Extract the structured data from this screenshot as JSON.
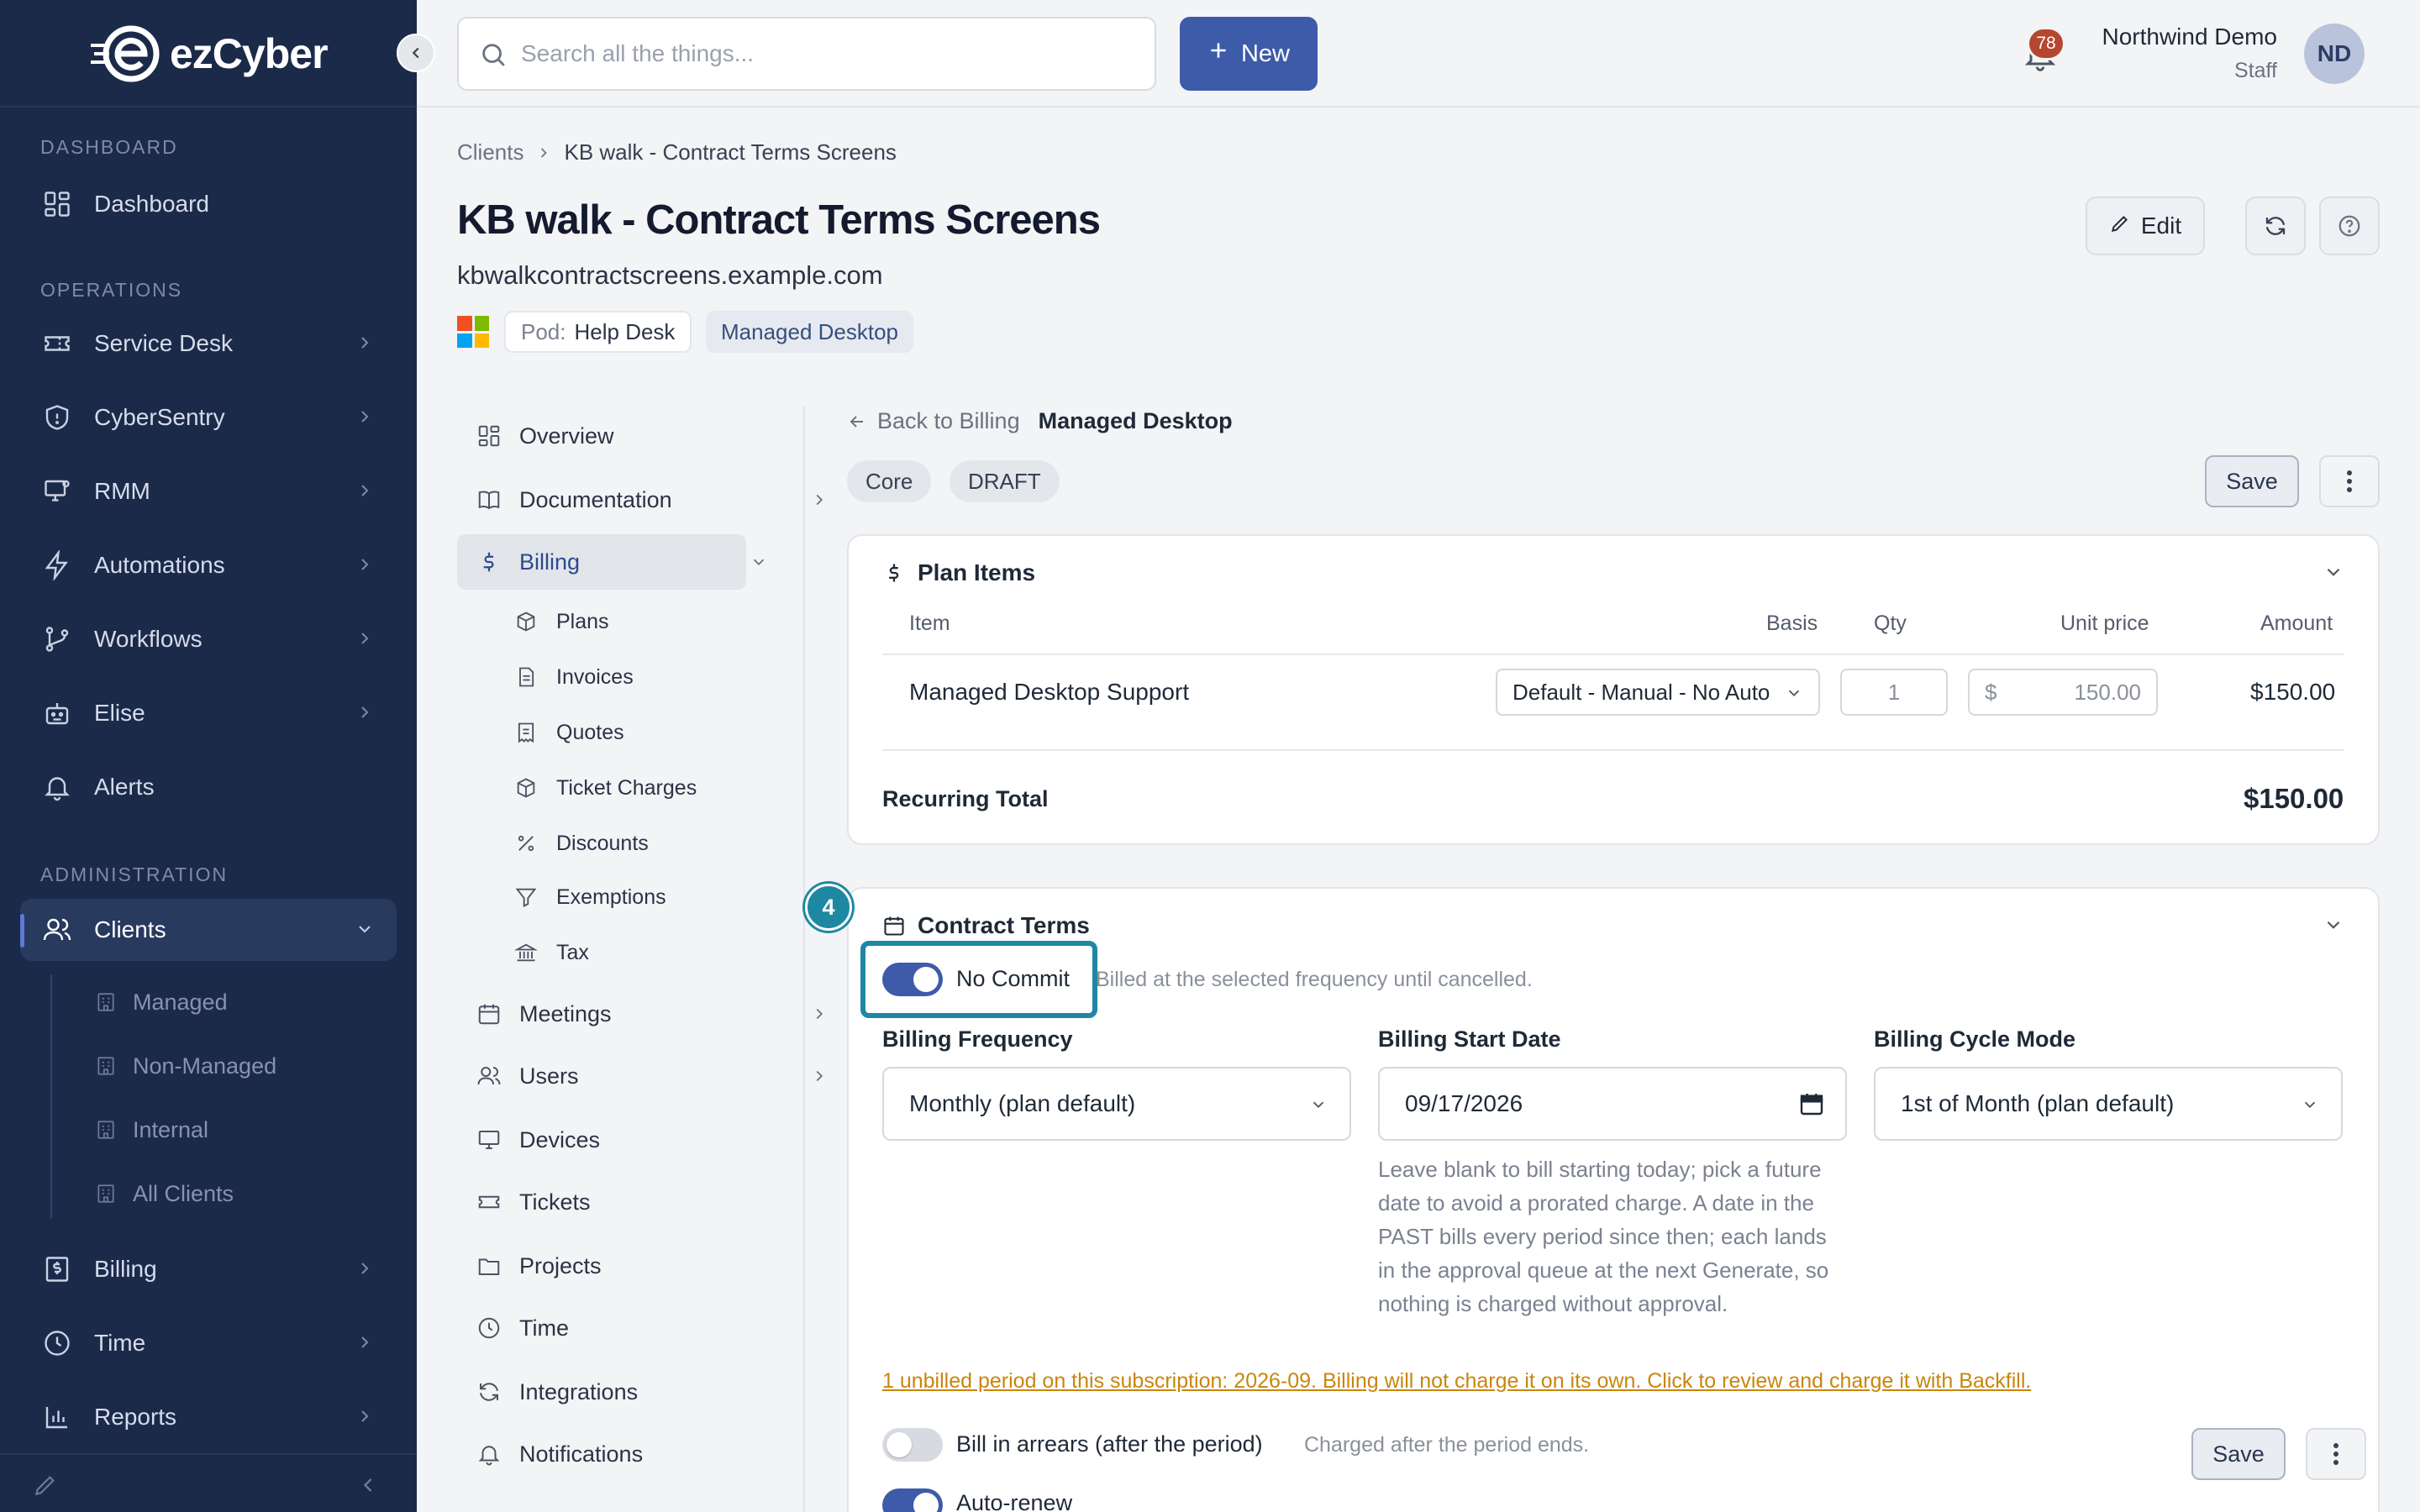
{
  "app": {
    "brand": "ezCyber"
  },
  "sidebar": {
    "sections": {
      "dashboard": "DASHBOARD",
      "operations": "OPERATIONS",
      "administration": "ADMINISTRATION"
    },
    "items": {
      "dashboard": "Dashboard",
      "service_desk": "Service Desk",
      "cybersentry": "CyberSentry",
      "rmm": "RMM",
      "automations": "Automations",
      "workflows": "Workflows",
      "elise": "Elise",
      "alerts": "Alerts",
      "clients": "Clients",
      "billing": "Billing",
      "time": "Time",
      "reports": "Reports"
    },
    "client_subitems": [
      "Managed",
      "Non-Managed",
      "Internal",
      "All Clients"
    ]
  },
  "topbar": {
    "search_placeholder": "Search all the things...",
    "new_label": "New",
    "notifications_count": "78",
    "user_name": "Northwind Demo",
    "user_role": "Staff",
    "user_initials": "ND"
  },
  "page": {
    "breadcrumb": {
      "root": "Clients",
      "current": "KB walk - Contract Terms Screens"
    },
    "title": "KB walk - Contract Terms Screens",
    "domain": "kbwalkcontractscreens.example.com",
    "pod_key": "Pod:",
    "pod_value": "Help Desk",
    "tag": "Managed Desktop",
    "edit_label": "Edit"
  },
  "client_nav": {
    "overview": "Overview",
    "documentation": "Documentation",
    "billing": "Billing",
    "billing_sub": [
      "Plans",
      "Invoices",
      "Quotes",
      "Ticket Charges",
      "Discounts",
      "Exemptions",
      "Tax"
    ],
    "meetings": "Meetings",
    "users": "Users",
    "devices": "Devices",
    "tickets": "Tickets",
    "projects": "Projects",
    "time": "Time",
    "integrations": "Integrations",
    "notifications": "Notifications"
  },
  "billing": {
    "back_label": "Back to Billing",
    "plan_name": "Managed Desktop",
    "tags": [
      "Core",
      "DRAFT"
    ],
    "save_label": "Save",
    "plan_items": {
      "title": "Plan Items",
      "columns": {
        "item": "Item",
        "basis": "Basis",
        "qty": "Qty",
        "unit_price": "Unit price",
        "amount": "Amount"
      },
      "rows": [
        {
          "item": "Managed Desktop Support",
          "basis": "Default - Manual - No Auto",
          "qty": "1",
          "currency": "$",
          "unit_price": "150.00",
          "amount": "$150.00"
        }
      ],
      "total_label": "Recurring Total",
      "total_value": "$150.00"
    },
    "contract_terms": {
      "step": "4",
      "title": "Contract Terms",
      "no_commit_label": "No Commit",
      "no_commit_on": true,
      "no_commit_desc": "Billed at the selected frequency until cancelled.",
      "frequency_label": "Billing Frequency",
      "frequency_value": "Monthly (plan default)",
      "start_label": "Billing Start Date",
      "start_value": "09/17/2026",
      "cycle_label": "Billing Cycle Mode",
      "cycle_value": "1st of Month (plan default)",
      "start_help": "Leave blank to bill starting today; pick a future date to avoid a prorated charge. A date in the PAST bills every period since then; each lands in the approval queue at the next Generate, so nothing is charged without approval.",
      "unbilled_warning": "1 unbilled period on this subscription: 2026-09. Billing will not charge it on its own. Click to review and charge it with Backfill.",
      "arrears_label": "Bill in arrears (after the period)",
      "arrears_desc": "Charged after the period ends.",
      "arrears_on": false,
      "autorenew_label": "Auto-renew",
      "autorenew_on": true,
      "save_label": "Save"
    }
  },
  "colors": {
    "sidebar": "#1c2a4a",
    "accent": "#3e5ba9",
    "highlight": "#1e88a3",
    "warning": "#c9860c"
  }
}
